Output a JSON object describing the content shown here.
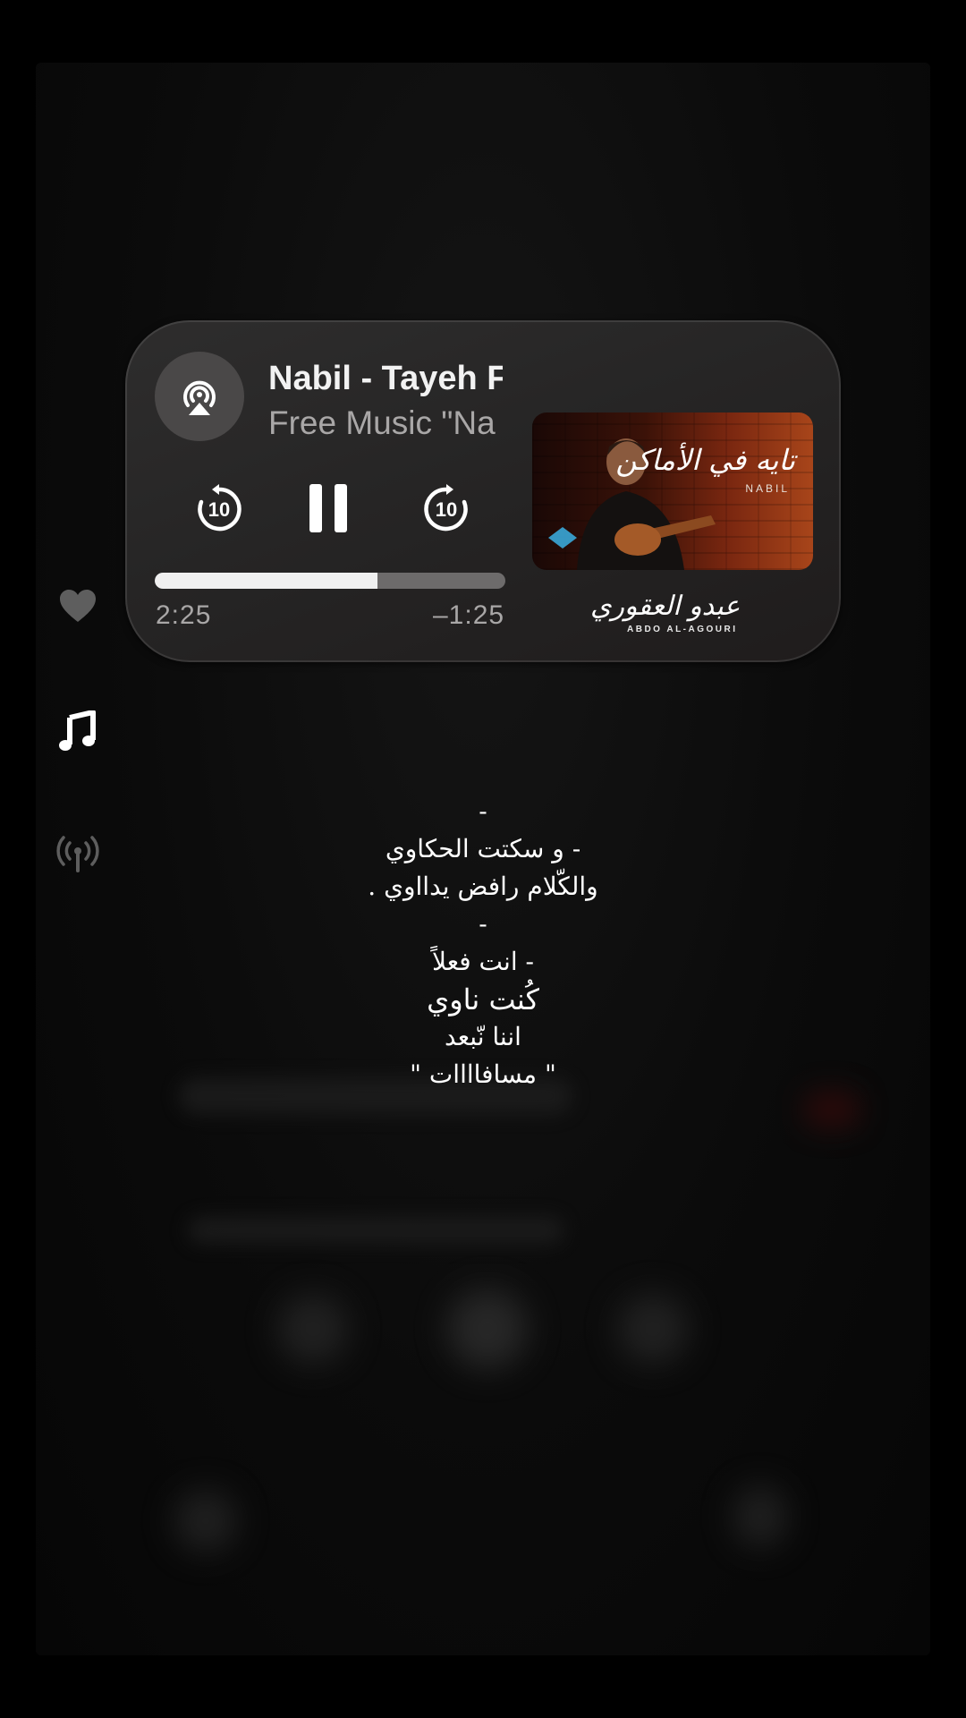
{
  "player": {
    "title": "Nabil - Tayeh F",
    "subtitle": "Free Music \"Na",
    "skip_back_seconds": "10",
    "skip_forward_seconds": "10",
    "elapsed": "2:25",
    "remaining": "–1:25",
    "progress": 0.635
  },
  "artwork": {
    "title": "تايه في الأماكن",
    "artist": "NABIL"
  },
  "label": {
    "arabic": "عبدو العقوري",
    "latin": "ABDO AL-AGOURI"
  },
  "side_icons": [
    "heart-icon",
    "music-note-icon",
    "broadcast-icon"
  ],
  "lyrics": [
    "-",
    "- و سكتت الحكاوي",
    "والكّلام رافض يدااوي .",
    "-",
    "- انت فعلاً",
    "كُنت  ناوي",
    "اننا نّبعد",
    "\" مسافاااات \""
  ],
  "colors": {
    "background": "#000000",
    "card": "#2a2929",
    "progress_fill": "#f0f0f0",
    "progress_track": "#6d6b6b",
    "secondary_text": "#a9a7a7"
  }
}
